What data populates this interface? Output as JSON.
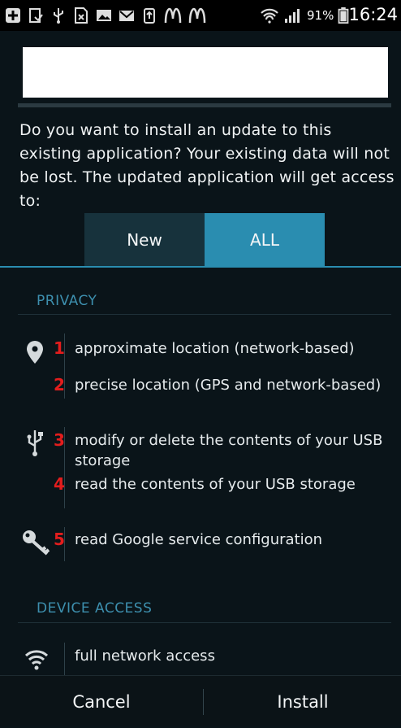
{
  "status_bar": {
    "icons": [
      "plus-box-icon",
      "clipboard-icon",
      "usb-icon",
      "no-sim-icon",
      "image-icon",
      "gmail-icon",
      "recycle-icon",
      "mcdonalds-icon",
      "mcdonalds-icon",
      "wifi-icon",
      "signal-icon",
      "battery-icon"
    ],
    "battery_percent": "91%",
    "time": "16:24"
  },
  "intro_text": "Do you want to install an update to this existing application? Your existing data will not be lost. The updated application will get access to:",
  "tabs": [
    {
      "label": "New",
      "selected": false
    },
    {
      "label": "ALL",
      "selected": true
    }
  ],
  "sections": {
    "privacy": {
      "title": "PRIVACY",
      "permissions": [
        {
          "badge": "1",
          "label": "approximate location (network-based)",
          "icon": "location-pin-icon"
        },
        {
          "badge": "2",
          "label": "precise location (GPS and network-based)"
        },
        {
          "badge": "3",
          "label": "modify or delete the contents of your USB",
          "label2": "storage",
          "icon": "usb-icon"
        },
        {
          "badge": "4",
          "label": "read the contents of your USB storage"
        },
        {
          "badge": "5",
          "label": "read Google service configuration",
          "icon": "key-icon"
        }
      ]
    },
    "device_access": {
      "title": "DEVICE ACCESS",
      "permissions": [
        {
          "label": "full network access",
          "icon": "wifi-icon"
        }
      ]
    }
  },
  "buttons": {
    "cancel": "Cancel",
    "install": "Install"
  },
  "colors": {
    "background": "#0a1419",
    "accent": "#2a8db0",
    "tab_unselected": "#17323c",
    "section_header": "#3d8fae",
    "badge": "#e31d1d"
  }
}
